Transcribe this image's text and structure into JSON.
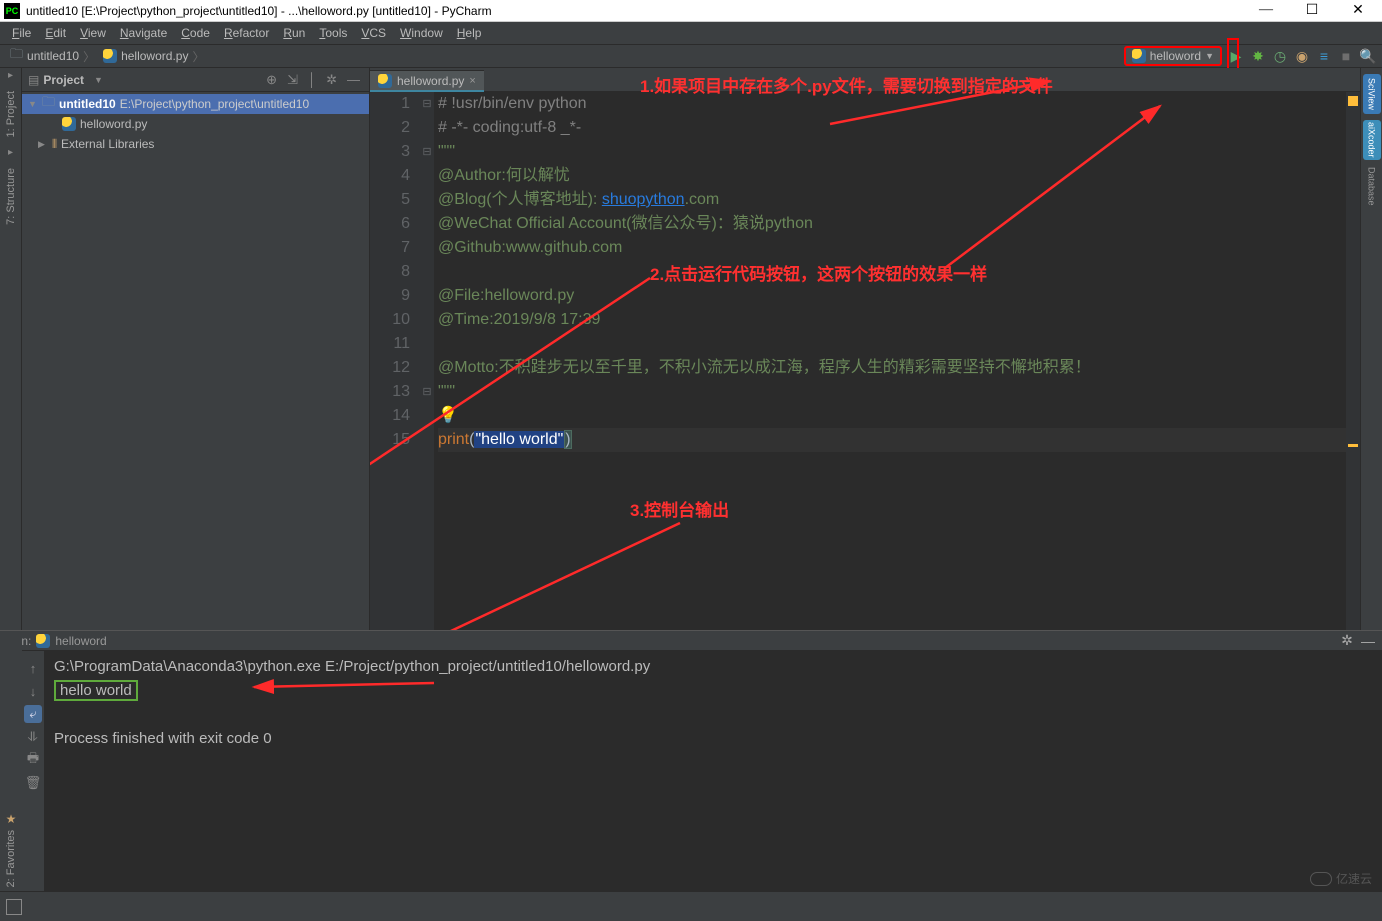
{
  "title": "untitled10 [E:\\Project\\python_project\\untitled10] - ...\\helloword.py [untitled10] - PyCharm",
  "menu": [
    "File",
    "Edit",
    "View",
    "Navigate",
    "Code",
    "Refactor",
    "Run",
    "Tools",
    "VCS",
    "Window",
    "Help"
  ],
  "breadcrumb": {
    "root": "untitled10",
    "file": "helloword.py"
  },
  "runConfig": "helloword",
  "projectPanel": {
    "title": "Project",
    "tree": {
      "rootName": "untitled10",
      "rootPath": "E:\\Project\\python_project\\untitled10",
      "file": "helloword.py",
      "extLib": "External Libraries"
    }
  },
  "editor": {
    "tab": "helloword.py",
    "lines": [
      {
        "n": 1,
        "html": "<span class='cmt'># !usr/bin/env python</span>"
      },
      {
        "n": 2,
        "html": "<span class='cmt'># -*- coding:utf-8 _*-</span>"
      },
      {
        "n": 3,
        "html": "<span class='str'>\"\"\"</span>"
      },
      {
        "n": 4,
        "html": "<span class='str'>@Author:何以解忧</span>"
      },
      {
        "n": 5,
        "html": "<span class='str'>@Blog(个人博客地址): </span><span class='lnk'>shuopython</span><span class='str'>.com</span>"
      },
      {
        "n": 6,
        "html": "<span class='str'>@WeChat Official Account(微信公众号)：猿说python</span>"
      },
      {
        "n": 7,
        "html": "<span class='str'>@Github:www.github.com</span>"
      },
      {
        "n": 8,
        "html": ""
      },
      {
        "n": 9,
        "html": "<span class='str'>@File:helloword.py</span>"
      },
      {
        "n": 10,
        "html": "<span class='str'>@Time:2019/9/8 17:39</span>"
      },
      {
        "n": 11,
        "html": ""
      },
      {
        "n": 12,
        "html": "<span class='str'>@Motto:不积跬步无以至千里，不积小流无以成江海，程序人生的精彩需要坚持不懈地积累！</span>"
      },
      {
        "n": 13,
        "html": "<span class='str'>\"\"\"</span>"
      },
      {
        "n": 14,
        "html": "<span class='bulb'>💡</span>"
      },
      {
        "n": 15,
        "html": "<span class='kwd'>print</span>(<span class='hilite'>\"hello world\"</span><span class='sel-bracket'>)</span>"
      }
    ]
  },
  "annotations": {
    "a1": "1.如果项目中存在多个.py文件，需要切换到指定的文件",
    "a2": "2.点击运行代码按钮，这两个按钮的效果一样",
    "a3": "3.控制台输出"
  },
  "run": {
    "title": "Run:",
    "config": "helloword",
    "cmd": "G:\\ProgramData\\Anaconda3\\python.exe E:/Project/python_project/untitled10/helloword.py",
    "out": "hello world",
    "exit": "Process finished with exit code 0"
  },
  "leftRail": {
    "project": "1: Project",
    "structure": "7: Structure",
    "favorites": "2: Favorites"
  },
  "rightRail": {
    "sci": "SciView",
    "aix": "aiXcoder",
    "db": "Database"
  },
  "watermark": "亿速云"
}
